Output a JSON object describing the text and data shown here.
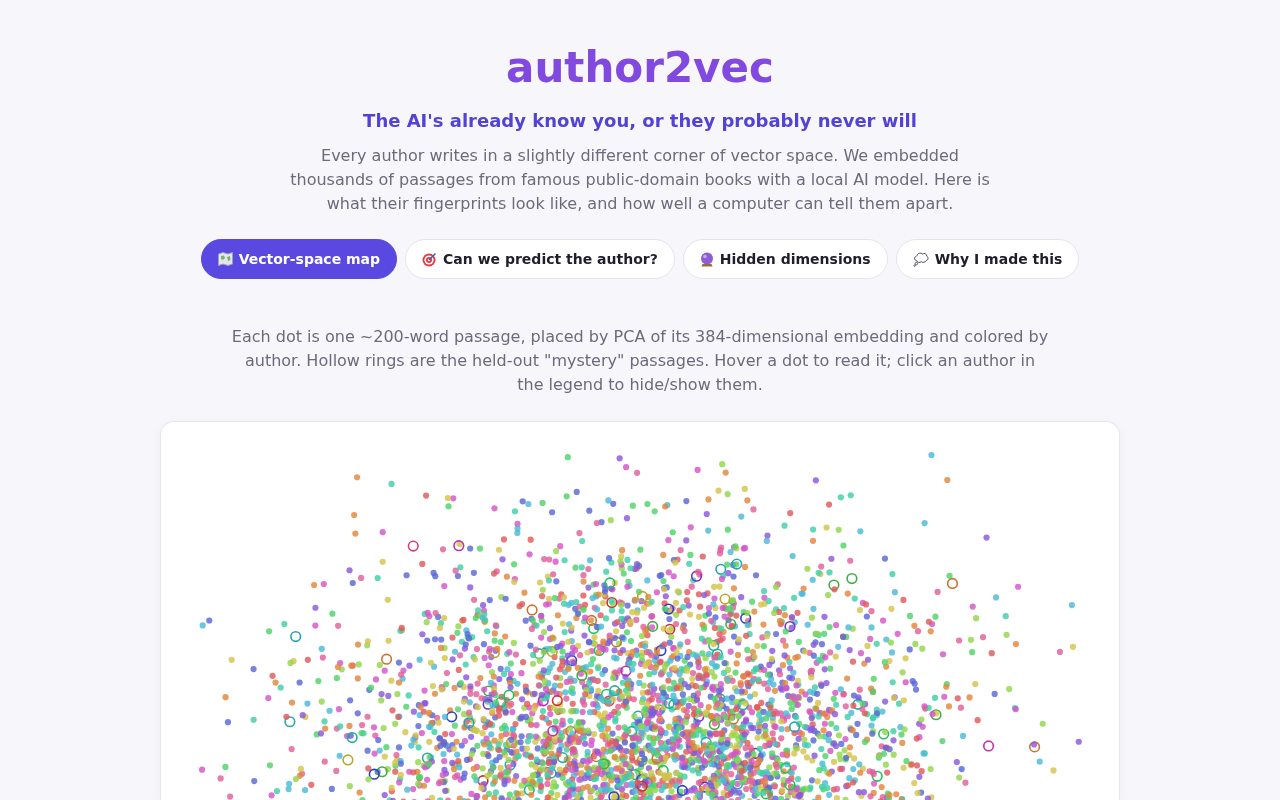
{
  "header": {
    "title": "author2vec",
    "subtitle": "The AI's already know you, or they probably never will",
    "intro": "Every author writes in a slightly different corner of vector space. We embedded thousands of passages from famous public-domain books with a local AI model. Here is what their fingerprints look like, and how well a computer can tell them apart."
  },
  "tabs": [
    {
      "label": "Vector-space map",
      "selected": true
    },
    {
      "label": "Can we predict the author?",
      "selected": false
    },
    {
      "label": "Hidden dimensions",
      "selected": false
    },
    {
      "label": "Why I made this",
      "selected": false
    }
  ],
  "map_view": {
    "description": "Each dot is one ~200-word passage, placed by PCA of its 384-dimensional embedding and colored by author. Hollow rings are the held-out \"mystery\" passages. Hover a dot to read it; click an author in the legend to hide/show them."
  }
}
